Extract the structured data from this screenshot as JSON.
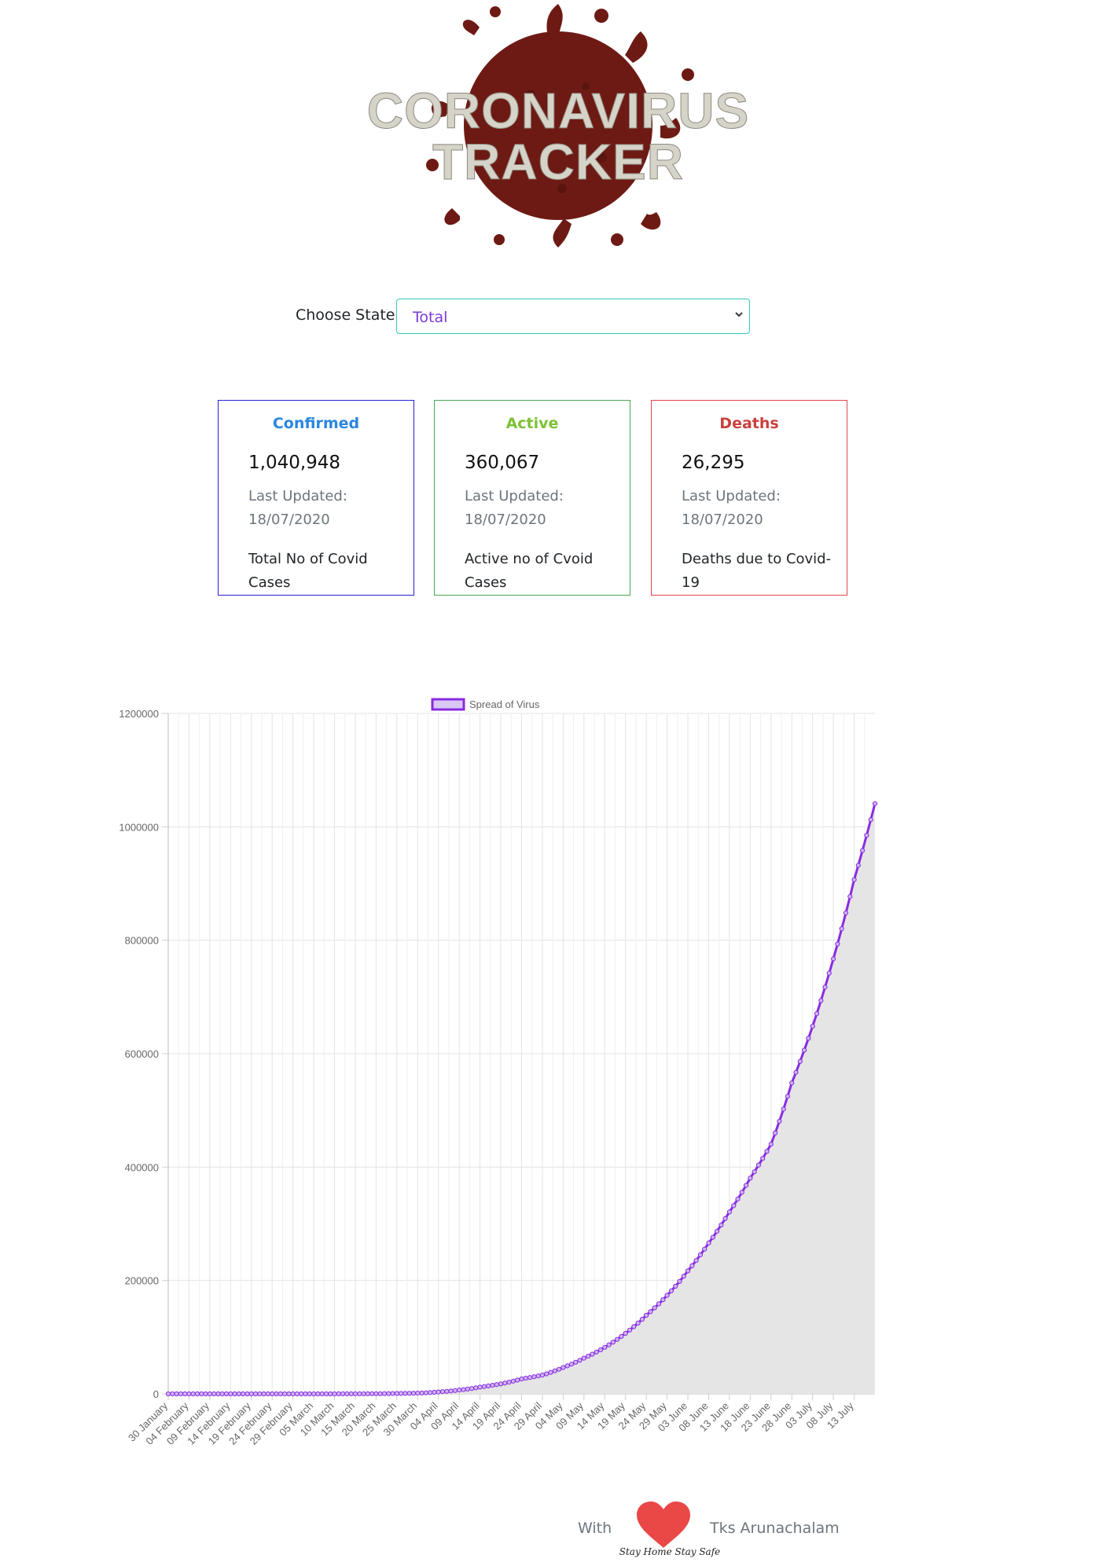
{
  "logo": {
    "line1": "CORONAVIRUS",
    "line2": "TRACKER"
  },
  "state_selector": {
    "label": "Choose State",
    "selected": "Total"
  },
  "cards": {
    "confirmed": {
      "title": "Confirmed",
      "count": "1,040,948",
      "updated_label": "Last Updated:",
      "updated_date": "18/07/2020",
      "description": "Total No of Covid Cases"
    },
    "active": {
      "title": "Active",
      "count": "360,067",
      "updated_label": "Last Updated:",
      "updated_date": "18/07/2020",
      "description": "Active no of Cvoid Cases"
    },
    "deaths": {
      "title": "Deaths",
      "count": "26,295",
      "updated_label": "Last Updated:",
      "updated_date": "18/07/2020",
      "description": "Deaths due to Covid-19"
    }
  },
  "colors": {
    "confirmed": "#2a86df",
    "active": "#7cc134",
    "deaths": "#c9413e",
    "line": "#8a2be2",
    "fill": "#e5e5e5",
    "select_border": "#33c7c0"
  },
  "chart_data": {
    "type": "area",
    "legend": [
      "Spread of Virus"
    ],
    "legend_position": "top",
    "grid": true,
    "start_date": "2020-01-30",
    "end_date": "2020-07-18",
    "x_tick_labels": [
      "30 January",
      "04 February",
      "09 February",
      "14 February",
      "19 February",
      "24 February",
      "29 February",
      "05 March",
      "10 March",
      "15 March",
      "20 March",
      "25 March",
      "30 March",
      "04 April",
      "09 April",
      "14 April",
      "19 April",
      "24 April",
      "29 April",
      "04 May",
      "09 May",
      "14 May",
      "19 May",
      "24 May",
      "29 May",
      "03 June",
      "08 June",
      "13 June",
      "18 June",
      "23 June",
      "28 June",
      "03 July",
      "08 July",
      "13 July"
    ],
    "y_tick_labels": [
      "0",
      "200000",
      "400000",
      "600000",
      "800000",
      "1000000",
      "1200000"
    ],
    "ylim": [
      0,
      1200000
    ],
    "series": [
      {
        "name": "Spread of Virus",
        "x": [
          "30 January",
          "04 February",
          "09 February",
          "14 February",
          "19 February",
          "24 February",
          "29 February",
          "05 March",
          "10 March",
          "15 March",
          "20 March",
          "25 March",
          "30 March",
          "04 April",
          "09 April",
          "14 April",
          "19 April",
          "24 April",
          "29 April",
          "04 May",
          "09 May",
          "14 May",
          "19 May",
          "24 May",
          "29 May",
          "03 June",
          "08 June",
          "13 June",
          "18 June",
          "23 June",
          "28 June",
          "03 July",
          "08 July",
          "13 July",
          "18 July"
        ],
        "values": [
          1,
          3,
          3,
          3,
          3,
          3,
          3,
          30,
          62,
          114,
          256,
          657,
          1251,
          3374,
          6725,
          11933,
          17615,
          26283,
          33062,
          46433,
          62939,
          81997,
          106750,
          138536,
          173763,
          216824,
          265928,
          320922,
          380532,
          440215,
          548318,
          648315,
          767296,
          906752,
          1040948
        ]
      }
    ]
  },
  "footer": {
    "with": "With",
    "thanks": "Tks Arunachalam",
    "tagline": "Stay Home Stay Safe"
  }
}
